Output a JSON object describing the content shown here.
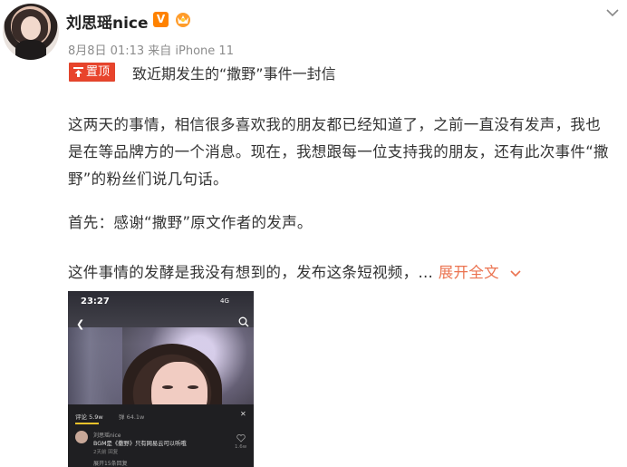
{
  "post": {
    "username": "刘思瑶nice",
    "verified_badge": "V",
    "meta": "8月8日 01:13 来自 iPhone 11",
    "pin_label": "置顶",
    "title": "致近期发生的“撒野”事件一封信",
    "paragraph1_line1": "这两天的事情，相信很多喜欢我的朋友都已经知道了，之前一直没有发声，我也",
    "paragraph1_line2": "是在等品牌方的一个消息。现在，我想跟每一位支持我的朋友，还有此次事件“撒",
    "paragraph1_line3": "野”的粉丝们说几句话。",
    "paragraph2": "首先：感谢“撒野”原文作者的发声。",
    "paragraph3": "这件事情的发酵是我没有想到的，发布这条短视频，…",
    "expand_label": "展开全文"
  },
  "video": {
    "time": "23:27",
    "status": "4G",
    "comments_count": "评论 5.9w",
    "danmu_label": "弹 64.1w",
    "commenter": "刘思瑶nice",
    "comment_text": "BGM是《撒野》只有网易云可以听哦",
    "comment_meta": "2天前  回复",
    "likes": "1.6w",
    "reply_hint": "展开15条回复"
  },
  "colors": {
    "accent": "#eb7350",
    "pin": "#e8442c",
    "verified": "#ff8200"
  },
  "icons": [
    "chevron-down-icon",
    "crown-icon",
    "pin-icon",
    "search-icon",
    "heart-icon",
    "back-icon"
  ]
}
